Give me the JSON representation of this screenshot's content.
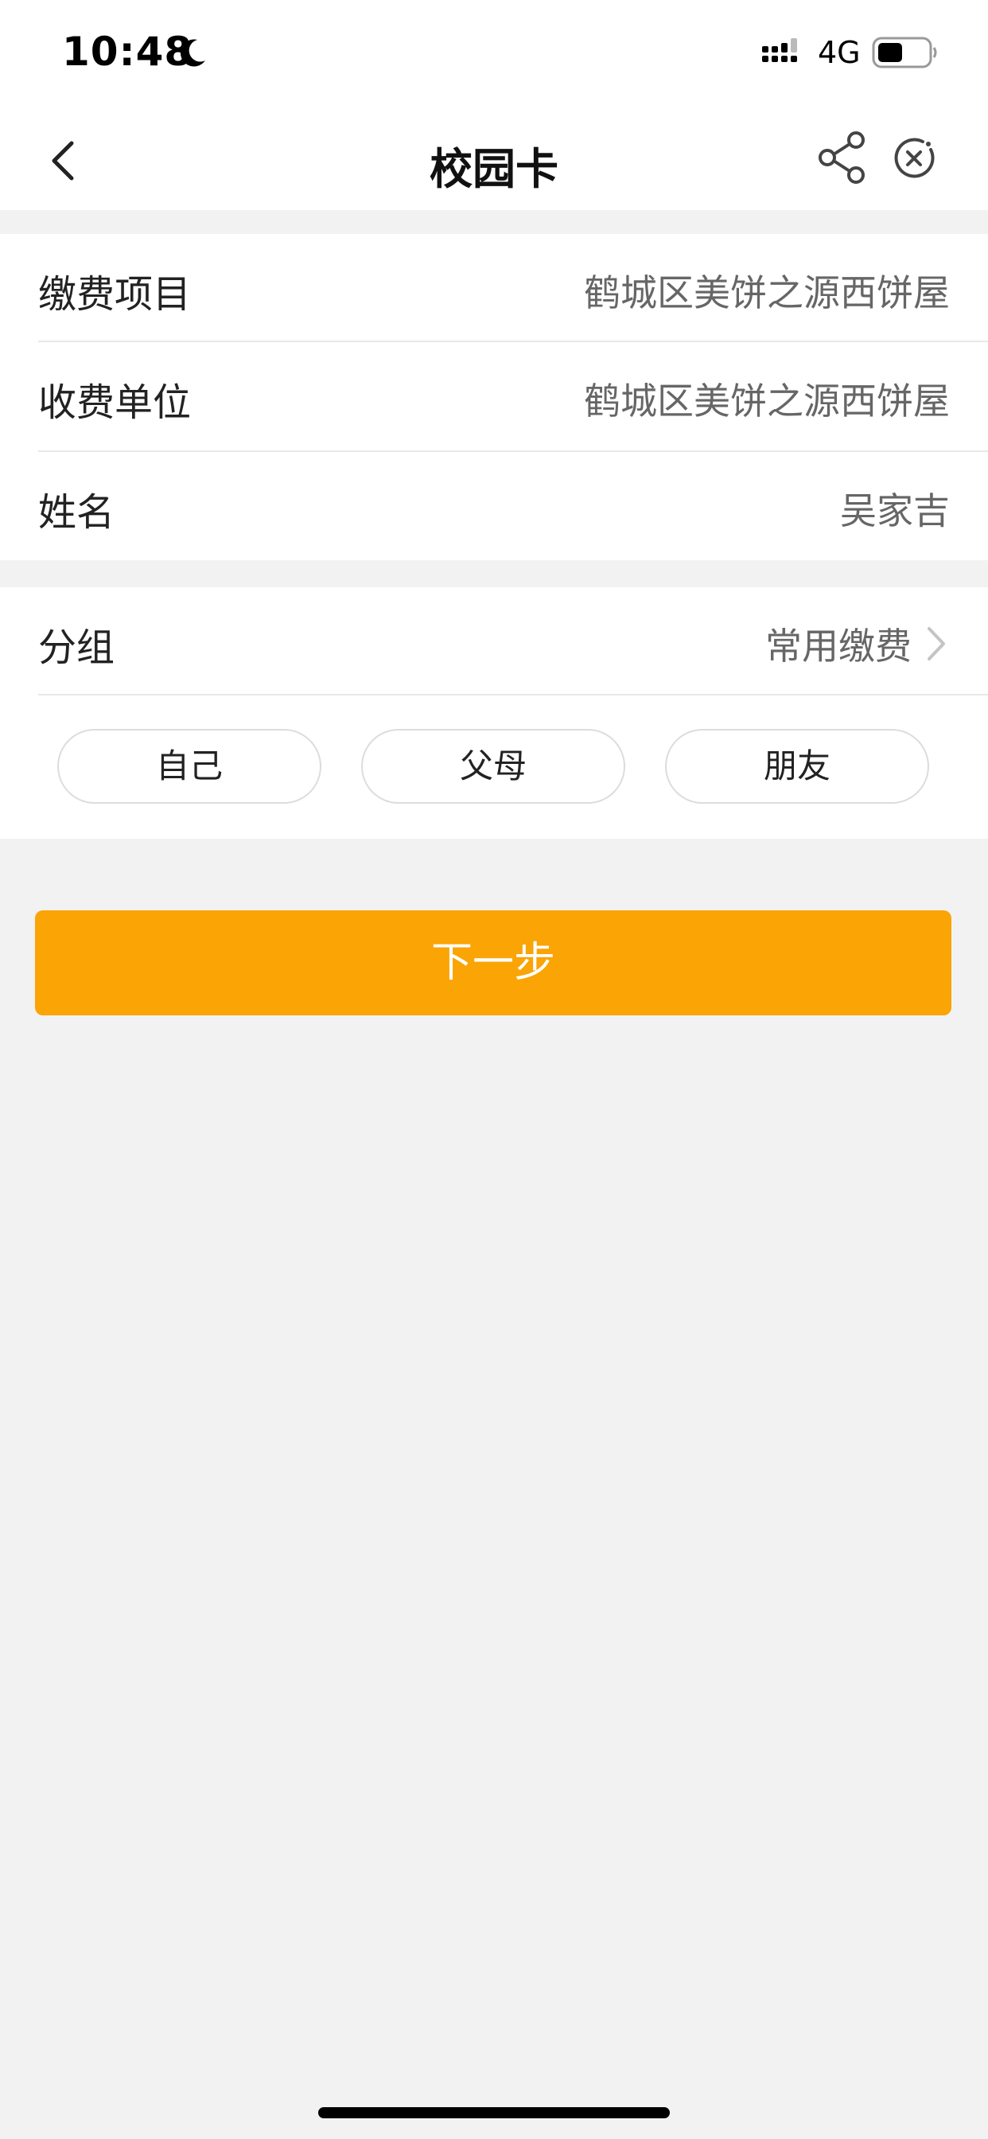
{
  "status_bar": {
    "time": "10:48",
    "network": "4G",
    "battery_level": 0.5,
    "icons": [
      "moon-icon",
      "signal-icon",
      "battery-icon"
    ]
  },
  "nav": {
    "title": "校园卡",
    "icons": [
      "back-icon",
      "share-icon",
      "close-icon"
    ]
  },
  "info_rows": [
    {
      "label": "缴费项目",
      "value": "鹤城区美饼之源西饼屋"
    },
    {
      "label": "收费单位",
      "value": "鹤城区美饼之源西饼屋"
    },
    {
      "label": "姓名",
      "value": "吴家吉"
    }
  ],
  "group": {
    "label": "分组",
    "value": "常用缴费",
    "options": [
      "自己",
      "父母",
      "朋友"
    ]
  },
  "next_button": {
    "label": "下一步"
  },
  "colors": {
    "accent": "#faa405",
    "background": "#f2f2f2",
    "card": "#ffffff",
    "value_text": "#666666"
  }
}
